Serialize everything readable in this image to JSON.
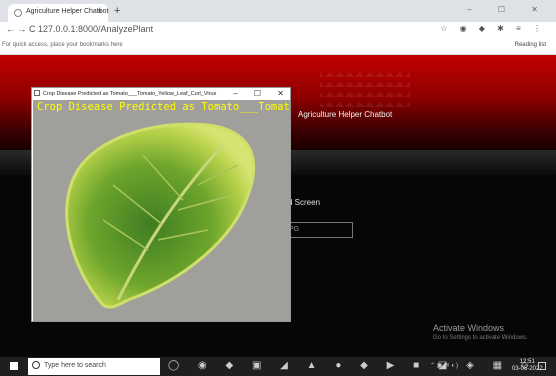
{
  "browser": {
    "tab_title": "Agriculture Helper Chatbot",
    "tab_close": "×",
    "new_tab": "+",
    "window_controls": "–  ☐  ✕",
    "nav_text": "←  →  C  127.0.0.1:8000/AnalyzePlant",
    "bookmarks_left": "For quick access, place your bookmarks here",
    "reading_list": "Reading list"
  },
  "page": {
    "header_title": "Agriculture Helper Chatbot",
    "upload_text": "d Screen",
    "file_input_text": "PG"
  },
  "popup": {
    "title": "Crop Disease Predicted as Tomato___Tomato_Yellow_Leaf_Curl_Virus",
    "minimize": "–",
    "maximize": "☐",
    "close": "✕",
    "overlay_text": "Crop Disease Predicted as Tomato___Tomato_Yellow_Leaf"
  },
  "watermark": {
    "line1": "Activate Windows",
    "line2": "Go to Settings to activate Windows."
  },
  "taskbar": {
    "search_placeholder": "Type here to search",
    "time": "12:51",
    "date": "03-05-2022"
  },
  "colors": {
    "banner_red": "#c10000",
    "overlay_text": "#ffff00",
    "page_bg": "#060606"
  }
}
